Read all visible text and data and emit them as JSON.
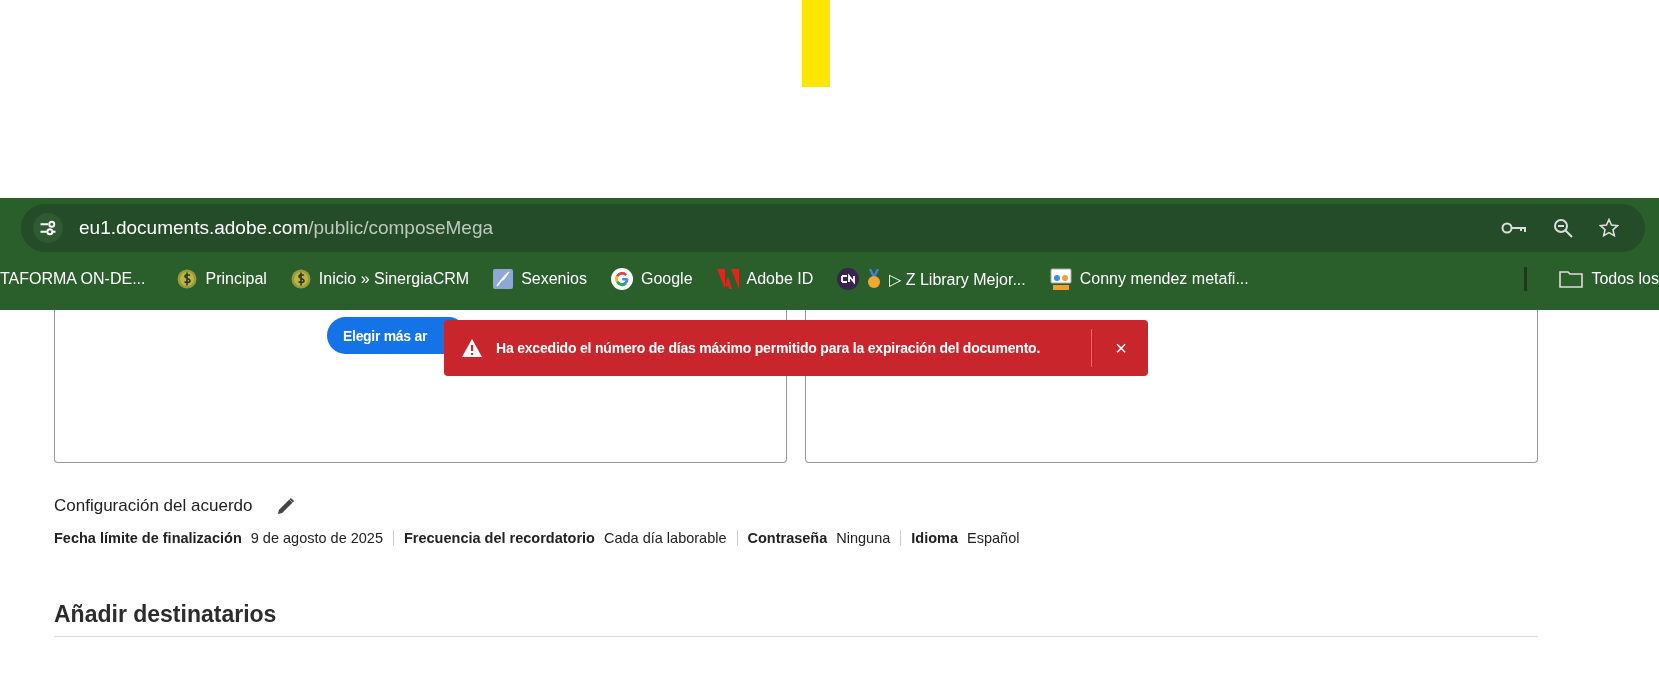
{
  "address_bar": {
    "host": "eu1.documents.adobe.com",
    "path": "/public/composeMega"
  },
  "bookmarks": [
    {
      "label": "TAFORMA ON-DE...",
      "kind": "none"
    },
    {
      "label": "Principal",
      "kind": "coin"
    },
    {
      "label": "Inicio » SinergiaCRM",
      "kind": "coin"
    },
    {
      "label": "Sexenios",
      "kind": "feather"
    },
    {
      "label": "Google",
      "kind": "google"
    },
    {
      "label": "Adobe ID",
      "kind": "adobe"
    },
    {
      "label": "▷ Z Library Mejor...",
      "kind": "cn"
    },
    {
      "label": "Conny mendez metafi...",
      "kind": "people"
    }
  ],
  "all_bookmarks": "Todos los",
  "choose_button": "Elegir más ar",
  "toast": {
    "message": "Ha excedido el número de días máximo permitido para la expiración del documento.",
    "close": "×"
  },
  "settings": {
    "title": "Configuración del acuerdo",
    "items": [
      {
        "label": "Fecha límite de finalización",
        "value": "9 de agosto de 2025"
      },
      {
        "label": "Frecuencia del recordatorio",
        "value": "Cada día laborable"
      },
      {
        "label": "Contraseña",
        "value": "Ninguna"
      },
      {
        "label": "Idioma",
        "value": "Español"
      }
    ]
  },
  "recipients_heading": "Añadir destinatarios"
}
